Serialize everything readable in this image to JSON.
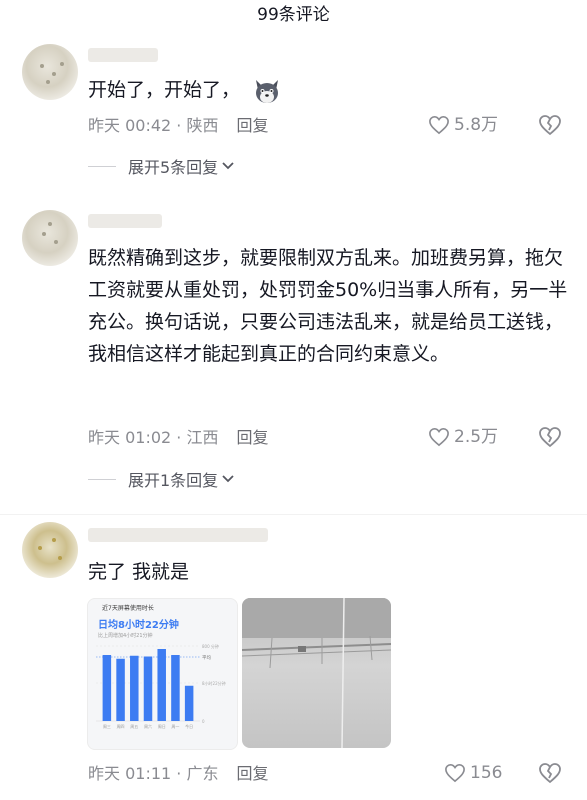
{
  "header": {
    "title": "99条评论"
  },
  "comments": [
    {
      "text": "开始了，开始了，",
      "emoji": "wolf-face-emoji",
      "meta": "昨天 00:42 · 陕西",
      "reply_label": "回复",
      "likes": "5.8万",
      "expand_label": "展开5条回复"
    },
    {
      "text": "既然精确到这步，就要限制双方乱来。加班费另算，拖欠工资就要从重处罚，处罚罚金50%归当事人所有，另一半充公。换句话说，只要公司违法乱来，就是给员工送钱，我相信这样才能起到真正的合同约束意义。",
      "meta": "昨天 01:02 · 江西",
      "reply_label": "回复",
      "likes": "2.5万",
      "expand_label": "展开1条回复"
    },
    {
      "text": "完了 我就是",
      "meta": "昨天 01:11 · 广东",
      "reply_label": "回复",
      "likes": "156",
      "image1": {
        "header": "近7天屏幕使用时长",
        "title": "日均8小时22分钟",
        "subtitle": "比上周增加4小时21分钟",
        "avg_label": "平均",
        "y_top": "800 分钟",
        "y_mid": "8小时22分钟",
        "y_zero": "0",
        "chart_data": {
          "type": "bar",
          "categories": [
            "周三",
            "周四",
            "周五",
            "周六",
            "周日",
            "周一",
            "今日"
          ],
          "values": [
            8.8,
            8.3,
            8.7,
            8.6,
            9.6,
            8.8,
            4.7
          ],
          "ylim": [
            0,
            10
          ]
        }
      }
    }
  ],
  "colors": {
    "bar": "#3d7cf2",
    "text": "#161823",
    "muted": "#8a8b91"
  }
}
